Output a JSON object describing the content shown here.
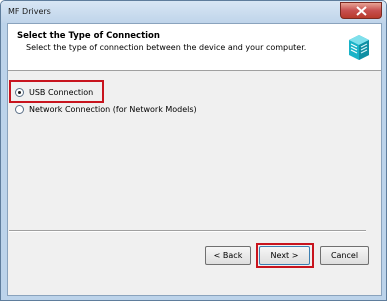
{
  "window": {
    "title": "MF Drivers"
  },
  "header": {
    "title": "Select the Type of Connection",
    "subtitle": "Select the type of connection between the device and your computer."
  },
  "options": [
    {
      "label": "USB Connection",
      "selected": true
    },
    {
      "label": "Network Connection (for Network Models)",
      "selected": false
    }
  ],
  "buttons": {
    "back": "< Back",
    "next": "Next >",
    "cancel": "Cancel"
  },
  "colors": {
    "highlight": "#c8141e",
    "titlebar": "#bcd3ea",
    "close_button": "#c75050"
  }
}
